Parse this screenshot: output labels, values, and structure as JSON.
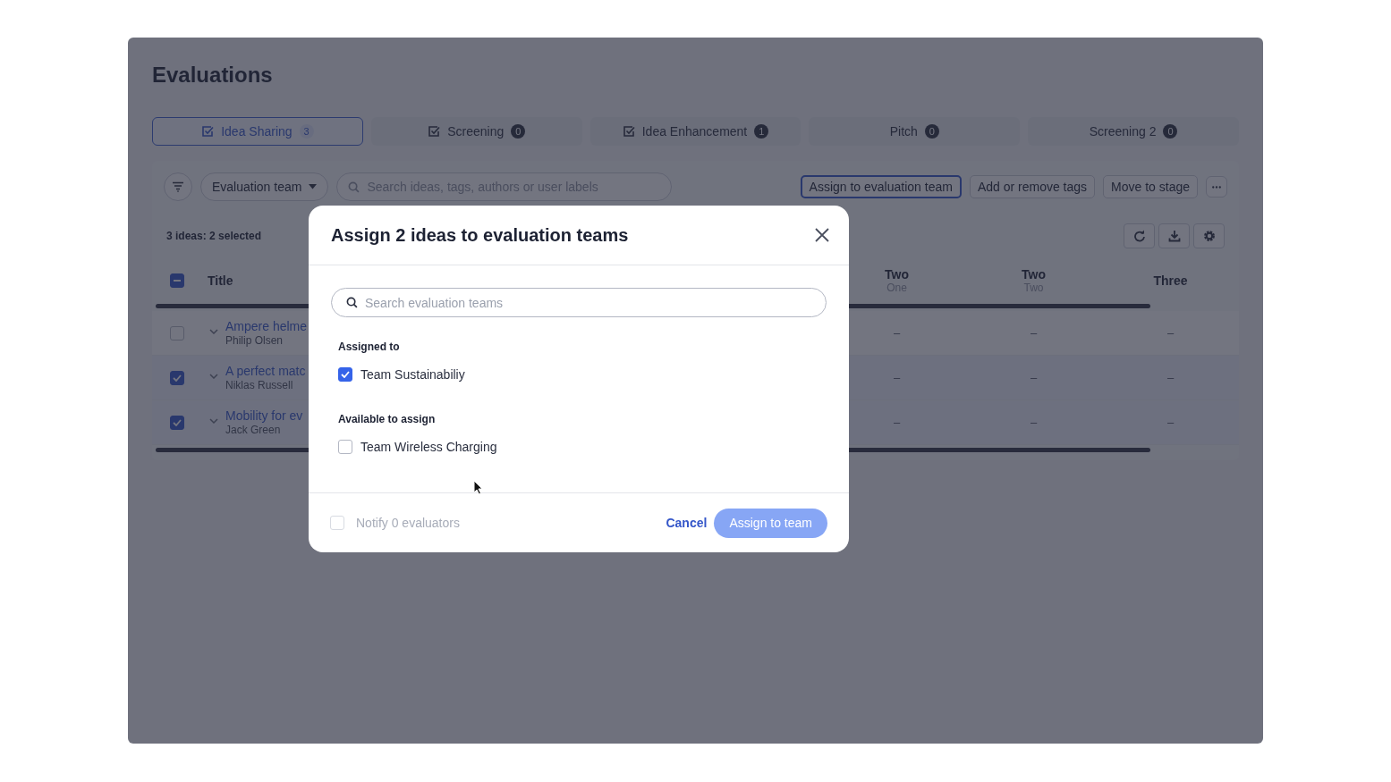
{
  "page": {
    "title": "Evaluations"
  },
  "tabs": [
    {
      "label": "Idea Sharing",
      "count": "3",
      "icon": true,
      "selected": true
    },
    {
      "label": "Screening",
      "count": "0",
      "icon": true,
      "selected": false
    },
    {
      "label": "Idea Enhancement",
      "count": "1",
      "icon": true,
      "selected": false
    },
    {
      "label": "Pitch",
      "count": "0",
      "icon": false,
      "selected": false
    },
    {
      "label": "Screening 2",
      "count": "0",
      "icon": false,
      "selected": false
    }
  ],
  "toolbar": {
    "filter_dropdown": "Evaluation team",
    "search": {
      "placeholder": "Search ideas, tags, authors or user labels"
    },
    "actions": [
      {
        "label": "Assign to evaluation team",
        "focused": true
      },
      {
        "label": "Add or remove tags",
        "focused": false
      },
      {
        "label": "Move to stage",
        "focused": false
      }
    ]
  },
  "table": {
    "summary": "3 ideas: 2 selected",
    "select_all_indeterminate": true,
    "columns": [
      {
        "title": "Title"
      },
      {
        "title": "Two",
        "subtitle": "One"
      },
      {
        "title": "Two",
        "subtitle": "Two"
      },
      {
        "title": "Three"
      }
    ],
    "rows": [
      {
        "title": "Ampere helme",
        "author": "Philip Olsen",
        "selected": false,
        "values": [
          "–",
          "–",
          "–"
        ]
      },
      {
        "title": "A perfect matc",
        "author": "Niklas Russell",
        "selected": true,
        "values": [
          "–",
          "–",
          "–"
        ]
      },
      {
        "title": "Mobility for ev",
        "author": "Jack Green",
        "selected": true,
        "values": [
          "–",
          "–",
          "–"
        ]
      }
    ]
  },
  "modal": {
    "title": "Assign 2 ideas to evaluation teams",
    "search": {
      "placeholder": "Search evaluation teams"
    },
    "sections": [
      {
        "heading": "Assigned to",
        "teams": [
          {
            "name": "Team Sustainabiliy",
            "checked": true
          }
        ]
      },
      {
        "heading": "Available to assign",
        "teams": [
          {
            "name": "Team Wireless Charging",
            "checked": false
          }
        ]
      }
    ],
    "notify": {
      "label": "Notify 0 evaluators",
      "checked": false,
      "disabled": true
    },
    "cancel": "Cancel",
    "submit": {
      "label": "Assign to team",
      "disabled": true
    }
  }
}
